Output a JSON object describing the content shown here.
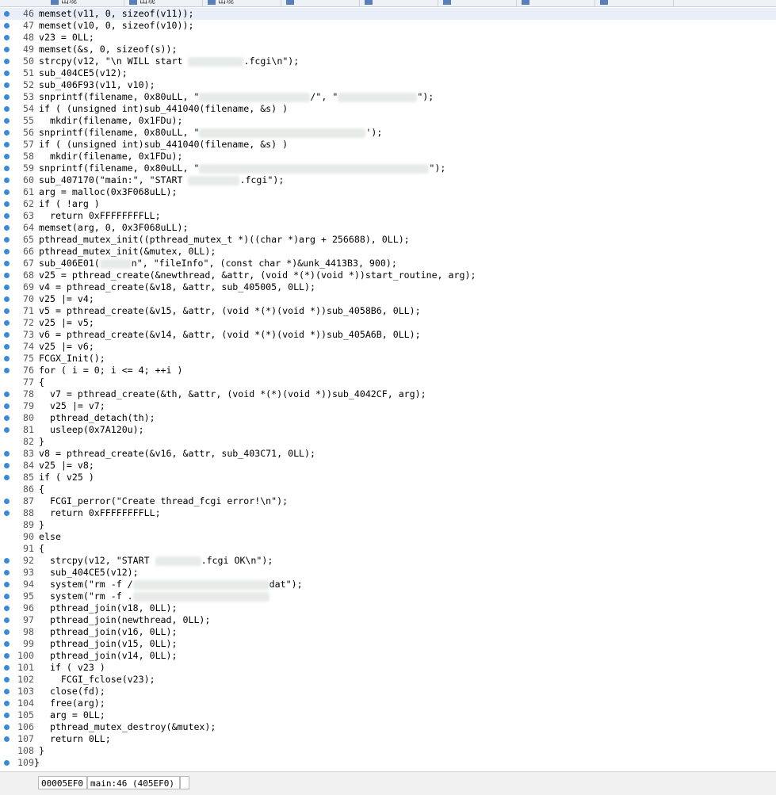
{
  "tabs": [
    {
      "label": "出现",
      "icon": "function-icon"
    },
    {
      "label": "出现",
      "icon": "function-icon"
    },
    {
      "label": "出现",
      "icon": "function-icon"
    },
    {
      "label": "",
      "icon": "view-icon"
    },
    {
      "label": "",
      "icon": "view-icon"
    },
    {
      "label": "",
      "icon": "view-icon"
    },
    {
      "label": "",
      "icon": "view-icon"
    },
    {
      "label": "",
      "icon": "view-icon"
    }
  ],
  "status": {
    "address": "00005EF0",
    "location": "main:46 (405EF0)"
  },
  "code_lines": [
    {
      "n": "46",
      "t": "memset(v11, 0, sizeof(v11));",
      "dot": true,
      "cur": true
    },
    {
      "n": "47",
      "t": "memset(v10, 0, sizeof(v10));",
      "dot": true
    },
    {
      "n": "48",
      "t": "v23 = 0LL;",
      "dot": true
    },
    {
      "n": "49",
      "t": "memset(&s, 0, sizeof(s));",
      "dot": true
    },
    {
      "n": "50",
      "t": "strcpy(v12, \"\\n WILL start ",
      "b": 70,
      "t2": ".fcgi\\n\");",
      "dot": true
    },
    {
      "n": "51",
      "t": "sub_404CE5(v12);",
      "dot": true
    },
    {
      "n": "52",
      "t": "sub_406F93(v11, v10);",
      "dot": true
    },
    {
      "n": "53",
      "t": "snprintf(filename, 0x80uLL, \"",
      "b": 140,
      "t2": "/\", \"",
      "b2": 100,
      "t3": "\");",
      "dot": true
    },
    {
      "n": "54",
      "t": "if ( (unsigned int)sub_441040(filename, &s) )",
      "dot": true
    },
    {
      "n": "55",
      "t": "  mkdir(filename, 0x1FDu);",
      "dot": true
    },
    {
      "n": "56",
      "t": "snprintf(filename, 0x80uLL, \"",
      "b": 210,
      "t2": "');",
      "dot": true
    },
    {
      "n": "57",
      "t": "if ( (unsigned int)sub_441040(filename, &s) )",
      "dot": true
    },
    {
      "n": "58",
      "t": "  mkdir(filename, 0x1FDu);",
      "dot": true
    },
    {
      "n": "59",
      "t": "snprintf(filename, 0x80uLL, \"",
      "b": 290,
      "t2": "\");",
      "dot": true
    },
    {
      "n": "60",
      "t": "sub_407170(\"main:\", \"START ",
      "b": 65,
      "t2": ".fcgi\");",
      "dot": true
    },
    {
      "n": "61",
      "t": "arg = malloc(0x3F068uLL);",
      "dot": true
    },
    {
      "n": "62",
      "t": "if ( !arg )",
      "dot": true
    },
    {
      "n": "63",
      "t": "  return 0xFFFFFFFFLL;",
      "dot": true
    },
    {
      "n": "64",
      "t": "memset(arg, 0, 0x3F068uLL);",
      "dot": true
    },
    {
      "n": "65",
      "t": "pthread_mutex_init((pthread_mutex_t *)((char *)arg + 256688), 0LL);",
      "dot": true
    },
    {
      "n": "66",
      "t": "pthread_mutex_init(&mutex, 0LL);",
      "dot": true
    },
    {
      "n": "67",
      "t": "sub_406E01(",
      "b": 40,
      "t2": "n\", \"fileInfo\", (const char *)&unk_4413B3, 900);",
      "dot": true
    },
    {
      "n": "68",
      "t": "v25 = pthread_create(&newthread, &attr, (void *(*)(void *))start_routine, arg);",
      "dot": true
    },
    {
      "n": "69",
      "t": "v4 = pthread_create(&v18, &attr, sub_405005, 0LL);",
      "dot": true
    },
    {
      "n": "70",
      "t": "v25 |= v4;",
      "dot": true
    },
    {
      "n": "71",
      "t": "v5 = pthread_create(&v15, &attr, (void *(*)(void *))sub_4058B6, 0LL);",
      "dot": true
    },
    {
      "n": "72",
      "t": "v25 |= v5;",
      "dot": true
    },
    {
      "n": "73",
      "t": "v6 = pthread_create(&v14, &attr, (void *(*)(void *))sub_405A6B, 0LL);",
      "dot": true
    },
    {
      "n": "74",
      "t": "v25 |= v6;",
      "dot": true
    },
    {
      "n": "75",
      "t": "FCGX_Init();",
      "dot": true
    },
    {
      "n": "76",
      "t": "for ( i = 0; i <= 4; ++i )",
      "dot": true
    },
    {
      "n": "77",
      "t": "{"
    },
    {
      "n": "78",
      "t": "  v7 = pthread_create(&th, &attr, (void *(*)(void *))sub_4042CF, arg);",
      "dot": true
    },
    {
      "n": "79",
      "t": "  v25 |= v7;",
      "dot": true
    },
    {
      "n": "80",
      "t": "  pthread_detach(th);",
      "dot": true
    },
    {
      "n": "81",
      "t": "  usleep(0x7A120u);",
      "dot": true
    },
    {
      "n": "82",
      "t": "}"
    },
    {
      "n": "83",
      "t": "v8 = pthread_create(&v16, &attr, sub_403C71, 0LL);",
      "dot": true
    },
    {
      "n": "84",
      "t": "v25 |= v8;",
      "dot": true
    },
    {
      "n": "85",
      "t": "if ( v25 )",
      "dot": true
    },
    {
      "n": "86",
      "t": "{"
    },
    {
      "n": "87",
      "t": "  FCGI_perror(\"Create thread_fcgi error!\\n\");",
      "dot": true
    },
    {
      "n": "88",
      "t": "  return 0xFFFFFFFFLL;",
      "dot": true
    },
    {
      "n": "89",
      "t": "}"
    },
    {
      "n": "90",
      "t": "else"
    },
    {
      "n": "91",
      "t": "{"
    },
    {
      "n": "92",
      "t": "  strcpy(v12, \"START ",
      "b": 58,
      "t2": ".fcgi OK\\n\");",
      "dot": true
    },
    {
      "n": "93",
      "t": "  sub_404CE5(v12);",
      "dot": true
    },
    {
      "n": "94",
      "t": "  system(\"rm -f /",
      "b": 172,
      "t2": "dat\");",
      "dot": true
    },
    {
      "n": "95",
      "t": "  system(\"rm -f .",
      "b": 172,
      "dot": true
    },
    {
      "n": "96",
      "t": "  pthread_join(v18, 0LL);",
      "dot": true
    },
    {
      "n": "97",
      "t": "  pthread_join(newthread, 0LL);",
      "dot": true
    },
    {
      "n": "98",
      "t": "  pthread_join(v16, 0LL);",
      "dot": true
    },
    {
      "n": "99",
      "t": "  pthread_join(v15, 0LL);",
      "dot": true
    },
    {
      "n": "100",
      "t": "  pthread_join(v14, 0LL);",
      "dot": true
    },
    {
      "n": "101",
      "t": "  if ( v23 )",
      "dot": true
    },
    {
      "n": "102",
      "t": "    FCGI_fclose(v23);",
      "dot": true
    },
    {
      "n": "103",
      "t": "  close(fd);",
      "dot": true
    },
    {
      "n": "104",
      "t": "  free(arg);",
      "dot": true
    },
    {
      "n": "105",
      "t": "  arg = 0LL;",
      "dot": true
    },
    {
      "n": "106",
      "t": "  pthread_mutex_destroy(&mutex);",
      "dot": true
    },
    {
      "n": "107",
      "t": "  return 0LL;",
      "dot": true
    },
    {
      "n": "108",
      "t": "}"
    },
    {
      "n": "109",
      "t": "}",
      "dot": true,
      "outer": true
    }
  ]
}
